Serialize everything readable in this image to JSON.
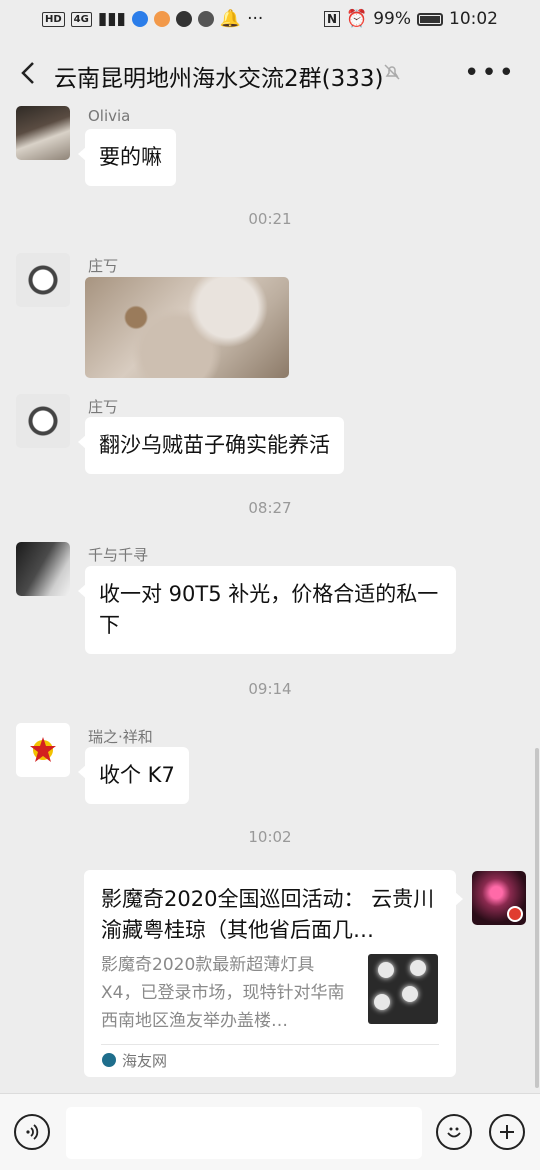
{
  "status_bar": {
    "left_tags": [
      "HD",
      "4G"
    ],
    "battery": "99%",
    "time": "10:02",
    "nfc_icon": "N"
  },
  "header": {
    "title": "云南昆明地州海水交流2群(333)",
    "mute_icon": "bell-mute-icon"
  },
  "messages": [
    {
      "sender": "Olivia",
      "text": "要的嘛"
    },
    {
      "time": "00:21"
    },
    {
      "sender": "庄丂",
      "type": "image"
    },
    {
      "sender": "庄丂",
      "text": "翻沙乌贼苗子确实能养活"
    },
    {
      "time": "08:27"
    },
    {
      "sender": "千与千寻",
      "text": "收一对 90T5 补光，价格合适的私一下"
    },
    {
      "time": "09:14"
    },
    {
      "sender": "瑞之·祥和",
      "text": "收个 K7"
    },
    {
      "time": "10:02"
    }
  ],
  "card": {
    "title": "影魔奇2020全国巡回活动： 云贵川渝藏粤桂琼（其他省后面几…",
    "description": "影魔奇2020款最新超薄灯具X4，已登录市场，现特针对华南西南地区渔友举办盖楼…",
    "source": "海友网"
  },
  "colors": {
    "background": "#ededed",
    "bubble": "#ffffff",
    "meta_text": "#999999"
  }
}
